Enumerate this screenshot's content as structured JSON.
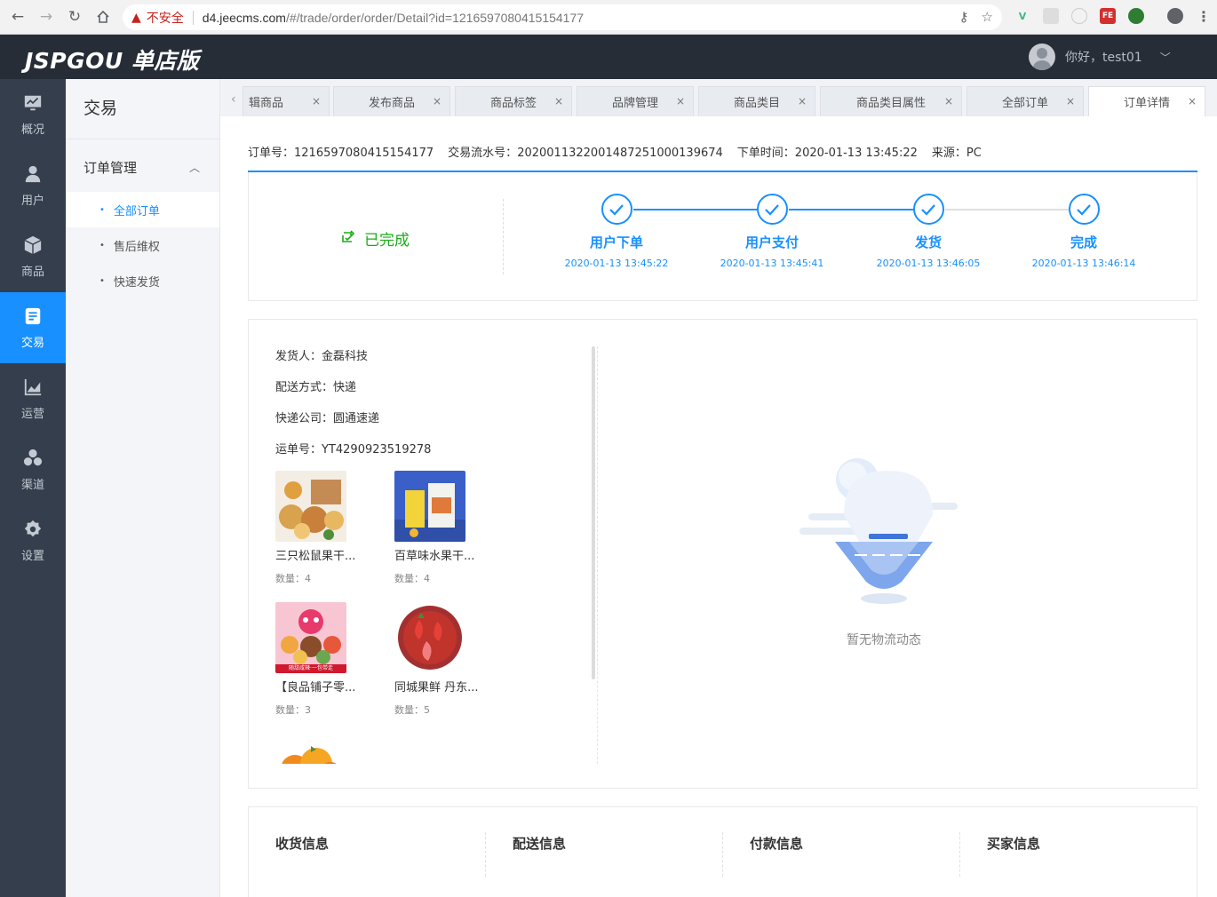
{
  "browser": {
    "insecure_label": "不安全",
    "url_host": "d4.jeecms.com",
    "url_path": "/#/trade/order/order/Detail?id=1216597080415154177"
  },
  "header": {
    "logo": "JSPGOU 单店版",
    "greeting": "你好，test01"
  },
  "icon_nav": [
    {
      "label": "概况",
      "icon": "monitor-icon"
    },
    {
      "label": "用户",
      "icon": "user-icon"
    },
    {
      "label": "商品",
      "icon": "cube-icon"
    },
    {
      "label": "交易",
      "icon": "document-icon",
      "active": true
    },
    {
      "label": "运营",
      "icon": "chart-icon"
    },
    {
      "label": "渠道",
      "icon": "hexagons-icon"
    },
    {
      "label": "设置",
      "icon": "gear-icon"
    }
  ],
  "sub_nav": {
    "title": "交易",
    "group": "订单管理",
    "items": [
      "全部订单",
      "售后维权",
      "快速发货"
    ]
  },
  "tabs": [
    "辑商品",
    "发布商品",
    "商品标签",
    "品牌管理",
    "商品类目",
    "商品类目属性",
    "全部订单",
    "订单详情"
  ],
  "order": {
    "no_label": "订单号：",
    "no": "1216597080415154177",
    "serial_label": "交易流水号：",
    "serial": "20200113220014872510001396­74",
    "time_label": "下单时间：",
    "time": "2020-01-13 13:45:22",
    "source_label": "来源：",
    "source": "PC"
  },
  "status": {
    "label": "已完成",
    "steps": [
      {
        "name": "用户下单",
        "time": "2020-01-13 13:45:22"
      },
      {
        "name": "用户支付",
        "time": "2020-01-13 13:45:41"
      },
      {
        "name": "发货",
        "time": "2020-01-13 13:46:05"
      },
      {
        "name": "完成",
        "time": "2020-01-13 13:46:14"
      }
    ]
  },
  "shipping": {
    "sender": "发货人：金磊科技",
    "method": "配送方式：快递",
    "company": "快递公司：圆通速递",
    "tracking": "运单号：YT4290923519278",
    "products": [
      {
        "name": "三只松鼠果干...",
        "qty": "数量：4"
      },
      {
        "name": "百草味水果干...",
        "qty": "数量：4"
      },
      {
        "name": "【良品铺子零...",
        "qty": "数量：3",
        "banner": "随甜咸辣·一包带走"
      },
      {
        "name": "同城果鲜 丹东...",
        "qty": "数量：5"
      },
      {
        "name": "",
        "qty": ""
      }
    ],
    "empty_text": "暂无物流动态"
  },
  "info_sections": [
    "收货信息",
    "配送信息",
    "付款信息",
    "买家信息"
  ],
  "colors": {
    "accent": "#1890ff",
    "done_green": "#1aad19",
    "header_bg": "#262d37",
    "sidebar_bg": "#343e4c"
  }
}
